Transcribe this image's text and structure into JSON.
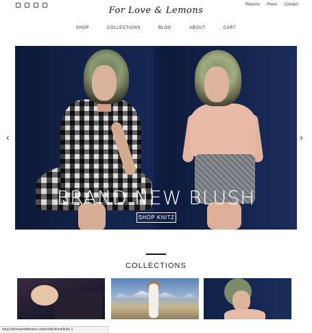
{
  "header": {
    "logo_text": "For Love & Lemons",
    "social_icons": [
      "facebook-icon",
      "twitter-icon",
      "instagram-icon",
      "pinterest-icon"
    ],
    "util_links": [
      "Returns",
      "Press",
      "Contact"
    ]
  },
  "nav": {
    "items": [
      "SHOP",
      "COLLECTIONS",
      "BLOG",
      "ABOUT",
      "CART"
    ]
  },
  "hero": {
    "title": "BRAND NEW BLUSH",
    "cta": "SHOP KNITZ",
    "prev_arrow": "‹",
    "next_arrow": "›"
  },
  "collections": {
    "title": "COLLECTIONS"
  },
  "status_bar": {
    "url": "shop.forloveandlemons.com/collections/knitz-1"
  }
}
